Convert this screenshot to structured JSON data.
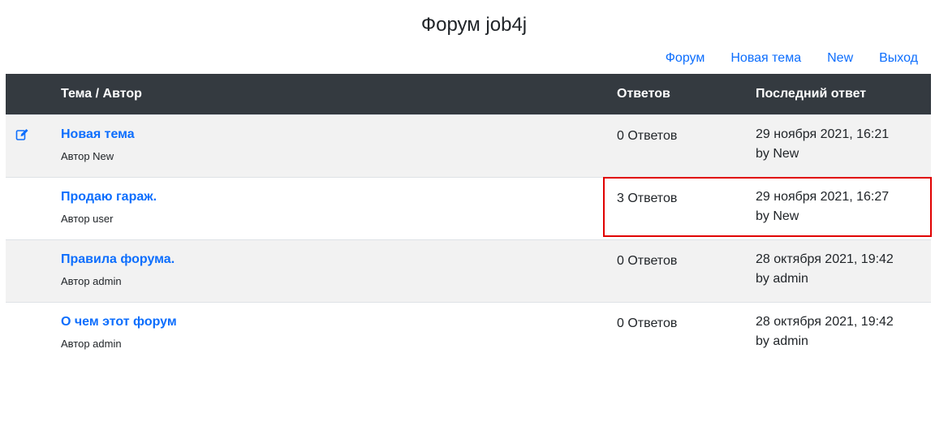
{
  "page": {
    "title": "Форум job4j"
  },
  "nav": {
    "items": [
      {
        "label": "Форум"
      },
      {
        "label": "Новая тема"
      },
      {
        "label": "New"
      },
      {
        "label": "Выход"
      }
    ]
  },
  "table": {
    "headers": {
      "topic": "Тема / Автор",
      "replies": "Ответов",
      "last": "Последний ответ"
    },
    "rows": [
      {
        "title": "Новая тема",
        "author": "Автор New",
        "replies": "0 Ответов",
        "last_date": "29 ноября 2021, 16:21",
        "last_by": "by New",
        "icon": "edit-icon"
      },
      {
        "title": "Продаю гараж.",
        "author": "Автор user",
        "replies": "3 Ответов",
        "last_date": "29 ноября 2021, 16:27",
        "last_by": "by New"
      },
      {
        "title": "Правила форума.",
        "author": "Автор admin",
        "replies": "0 Ответов",
        "last_date": "28 октября 2021, 19:42",
        "last_by": "by admin"
      },
      {
        "title": "О чем этот форум",
        "author": "Автор admin",
        "replies": "0 Ответов",
        "last_date": "28 октября 2021, 19:42",
        "last_by": "by admin"
      }
    ]
  },
  "colors": {
    "link": "#0d6efd",
    "header_bg": "#343a40",
    "highlight": "#e00000",
    "row_striped": "#f2f2f2"
  }
}
